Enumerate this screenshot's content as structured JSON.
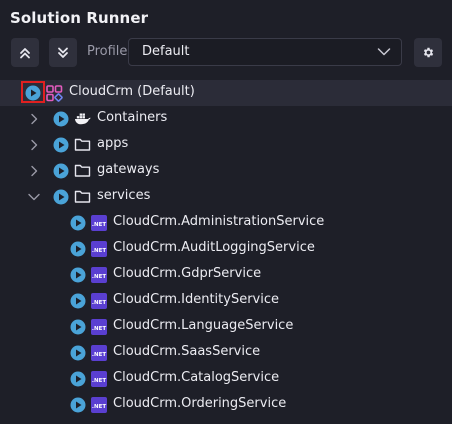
{
  "panel": {
    "title": "Solution Runner"
  },
  "toolbar": {
    "profile_label": "Profile:",
    "profile_value": "Default"
  },
  "tree": {
    "root": {
      "label": "CloudCrm (Default)"
    },
    "folders": [
      {
        "label": "Containers",
        "icon": "docker-icon",
        "expanded": false
      },
      {
        "label": "apps",
        "icon": "folder-icon",
        "expanded": false
      },
      {
        "label": "gateways",
        "icon": "folder-icon",
        "expanded": false
      },
      {
        "label": "services",
        "icon": "folder-icon",
        "expanded": true
      }
    ],
    "services": [
      {
        "label": "CloudCrm.AdministrationService"
      },
      {
        "label": "CloudCrm.AuditLoggingService"
      },
      {
        "label": "CloudCrm.GdprService"
      },
      {
        "label": "CloudCrm.IdentityService"
      },
      {
        "label": "CloudCrm.LanguageService"
      },
      {
        "label": "CloudCrm.SaasService"
      },
      {
        "label": "CloudCrm.CatalogService"
      },
      {
        "label": "CloudCrm.OrderingService"
      }
    ],
    "dotnet_badge": ".NET"
  },
  "colors": {
    "background": "#1e1f28",
    "play": "#4aa3d8",
    "dotnet": "#5a3fd1",
    "highlight": "#e02020"
  }
}
